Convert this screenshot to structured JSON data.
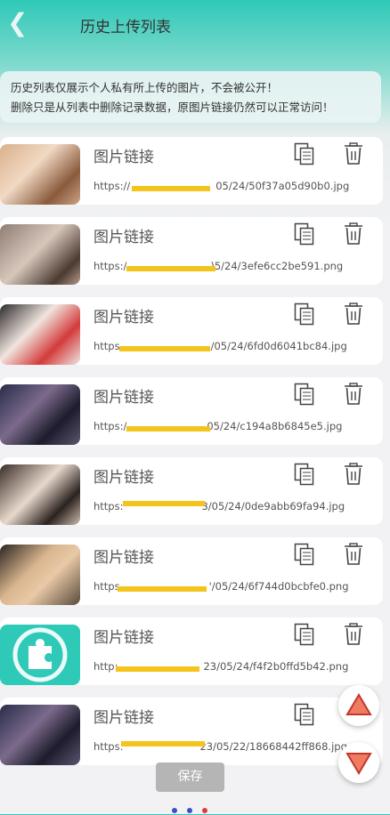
{
  "header": {
    "title": "历史上传列表"
  },
  "notice": {
    "line1": "历史列表仅展示个人私有所上传的图片，不会被公开！",
    "line2": "删除只是从列表中删除记录数据，原图片链接仍然可以正常访问！"
  },
  "items": [
    {
      "label": "图片链接",
      "url_start": "https://",
      "url_end": "05/24/50f37a05d90b0.jpg"
    },
    {
      "label": "图片链接",
      "url_start": "https:/",
      "url_end": ")5/24/3efe6cc2be591.png"
    },
    {
      "label": "图片链接",
      "url_start": "https",
      "url_end": "/05/24/6fd0d6041bc84.jpg"
    },
    {
      "label": "图片链接",
      "url_start": "https:/",
      "url_end": "05/24/c194a8b6845e5.jpg"
    },
    {
      "label": "图片链接",
      "url_start": "https:",
      "url_end": "3/05/24/0de9abb69fa94.jpg"
    },
    {
      "label": "图片链接",
      "url_start": "https",
      "url_end": "'/05/24/6f744d0bcbfe0.png"
    },
    {
      "label": "图片链接",
      "url_start": "http:",
      "url_end": "23/05/24/f4f2b0ffd5b42.png"
    },
    {
      "label": "图片链接",
      "url_start": "https:",
      "url_end": "23/05/22/18668442ff868.jpg"
    }
  ],
  "save_button": "保存",
  "colors": {
    "accent": "#2fc9b8",
    "redacted": "#f4c41c",
    "arrow": "#e8604c"
  },
  "icons": {
    "back": "chevron-left-icon",
    "copy": "copy-icon",
    "delete": "trash-icon",
    "up": "scroll-up-icon",
    "down": "scroll-down-icon"
  }
}
